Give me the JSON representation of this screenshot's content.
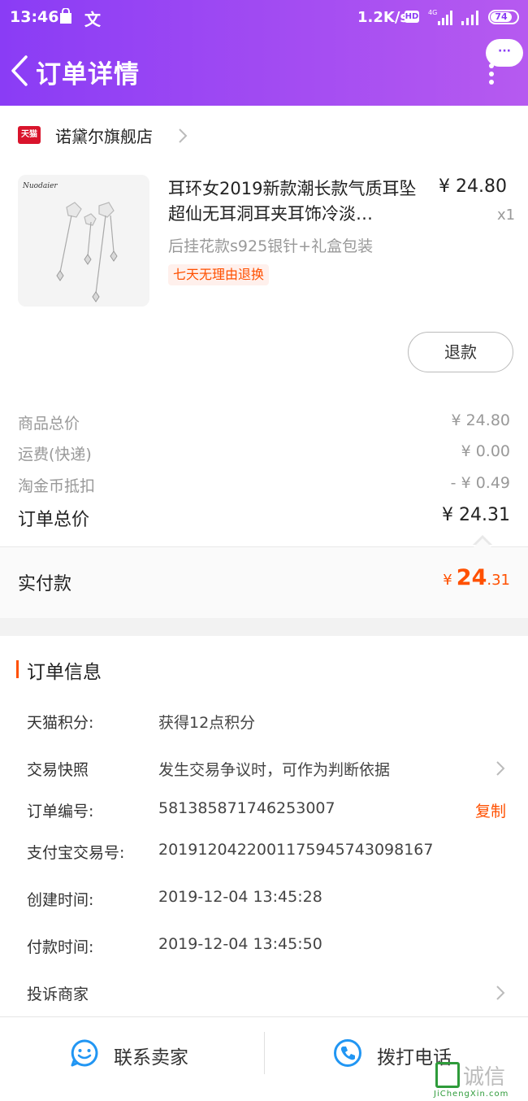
{
  "status_bar": {
    "time": "13:46",
    "translate_glyph": "文",
    "net_speed": "1.2K/s",
    "hd": "HD",
    "network": "4G",
    "battery": "74"
  },
  "nav": {
    "title": "订单详情",
    "more_label": "···"
  },
  "shop": {
    "logo_text": "天猫",
    "name": "诺黛尔旗舰店"
  },
  "product": {
    "image_brand": "Nuodaier",
    "title": "耳环女2019新款潮长款气质耳坠超仙无耳洞耳夹耳饰冷淡…",
    "price": "¥ 24.80",
    "quantity": "x1",
    "sku": "后挂花款s925银针+礼盒包装",
    "tag": "七天无理由退换",
    "refund_button": "退款"
  },
  "fees": [
    {
      "label": "商品总价",
      "value": "¥ 24.80"
    },
    {
      "label": "运费(快递)",
      "value": "¥ 0.00"
    },
    {
      "label": "淘金币抵扣",
      "value": "- ¥ 0.49"
    },
    {
      "label": "订单总价",
      "value": "¥ 24.31"
    }
  ],
  "paid": {
    "label": "实付款",
    "symbol": "¥",
    "integer": "24",
    "decimal": ".31"
  },
  "order_info": {
    "title": "订单信息",
    "rows": [
      {
        "key": "天猫积分:",
        "value": "获得12点积分"
      },
      {
        "key": "交易快照",
        "value": "发生交易争议时，可作为判断依据"
      },
      {
        "key": "订单编号:",
        "value": "581385871746253007",
        "action": "复制"
      },
      {
        "key": "支付宝交易号:",
        "value": "2019120422001175945743098167"
      },
      {
        "key": "创建时间:",
        "value": "2019-12-04 13:45:28"
      },
      {
        "key": "付款时间:",
        "value": "2019-12-04 13:45:50"
      },
      {
        "key": "投诉商家",
        "value": ""
      }
    ]
  },
  "bottom_bar": {
    "contact_seller": "联系卖家",
    "call_phone": "拨打电话"
  },
  "watermark": {
    "text": "诚信",
    "sub": "JiChengXin.com"
  },
  "colors": {
    "header_start": "#8a3cf5",
    "header_end": "#b65af0",
    "accent": "#ff5000",
    "tmall_red": "#d9142c",
    "icon_blue": "#2196f3"
  }
}
